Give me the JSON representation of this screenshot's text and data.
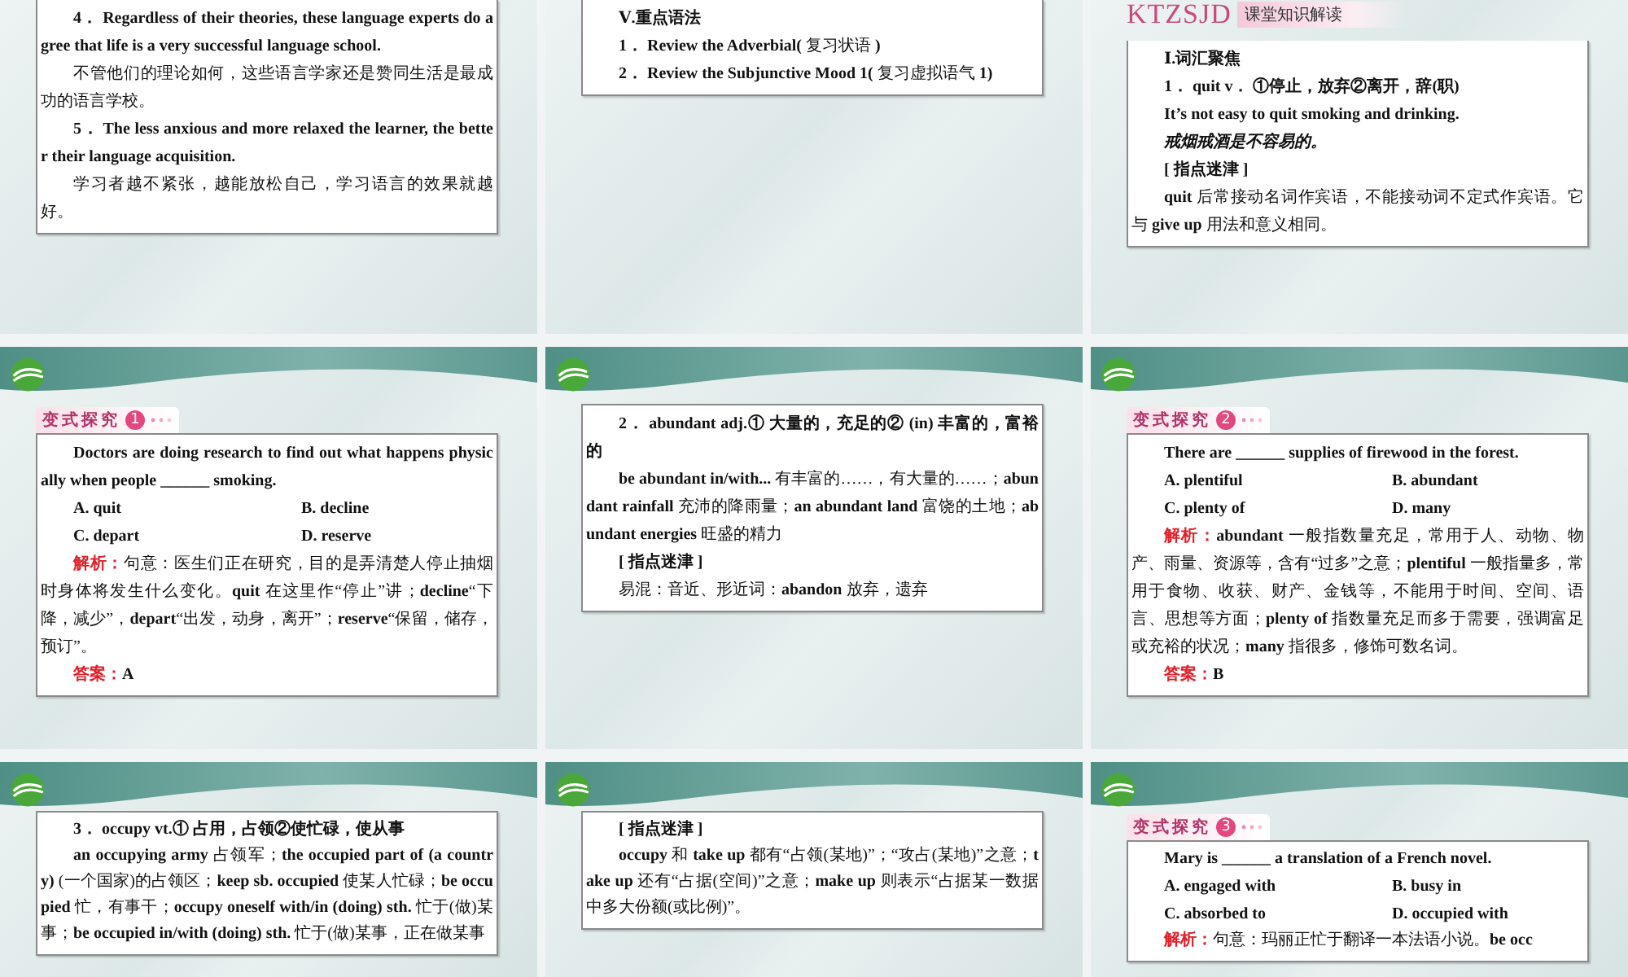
{
  "slides": [
    {
      "kind": "lower-part",
      "box": [
        {
          "kind": "strong",
          "text": "4． Regardless of their theories, these language experts do agree that life is a very successful language school."
        },
        {
          "kind": "body",
          "text": "不管他们的理论如何，这些语言学家还是赞同生活是最成功的语言学校。"
        },
        {
          "kind": "strong",
          "text": "5． The less anxious and more relaxed the learner, the better their language acquisition."
        },
        {
          "kind": "body",
          "text": "学习者越不紧张，越能放松自己，学习语言的效果就越好。"
        }
      ]
    },
    {
      "kind": "lower-part",
      "box": [
        {
          "kind": "strong",
          "text": "Ⅴ.重点语法"
        },
        {
          "kind": "body",
          "text": "**1． Review the Adverbial(** 复习状语 **)**"
        },
        {
          "kind": "body",
          "text": "**2． Review the Subjunctive Mood 1(** 复习虚拟语气 **1)**"
        }
      ]
    },
    {
      "kind": "lower-part",
      "section": {
        "code": "KTZSJD",
        "title": "课堂知识解读"
      },
      "box": [
        {
          "kind": "strong",
          "text": "Ⅰ.词汇聚焦"
        },
        {
          "kind": "strong",
          "text": "1． quit v． ①停止，放弃②离开，辞(职)"
        },
        {
          "kind": "strong",
          "text": "It’s not easy to quit smoking and drinking."
        },
        {
          "kind": "example",
          "text": "戒烟戒酒是不容易的。"
        },
        {
          "kind": "strong",
          "text": "[ 指点迷津 ]"
        },
        {
          "kind": "body",
          "text": "**quit** 后常接动名词作宾语，不能接动词不定式作宾语。它与 **give up** 用法和意义相同。"
        }
      ]
    },
    {
      "kind": "full",
      "tag": {
        "label": "变式探究",
        "number": "1"
      },
      "box": [
        {
          "kind": "strong",
          "text": "Doctors are doing research to find out what happens physically when people ______ smoking."
        },
        {
          "kind": "options",
          "options": [
            "A. quit",
            "B. decline"
          ]
        },
        {
          "kind": "options",
          "options": [
            "C. depart",
            "D. reserve"
          ]
        },
        {
          "kind": "note",
          "label": "解析：",
          "text": "句意：医生们正在研究，目的是弄清楚人停止抽烟时身体将发生什么变化。**quit** 在这里作“停止”讲；**decline**“下降，减少”，**depart**“出发，动身，离开”；**reserve**“保留，储存，预订”。"
        },
        {
          "kind": "note",
          "label": "答案：",
          "text": "**A**"
        }
      ]
    },
    {
      "kind": "full",
      "box": [
        {
          "kind": "strong",
          "text": "2． abundant adj.① 大量的，充足的② (in) 丰富的，富裕的"
        },
        {
          "kind": "body",
          "text": "**be abundant in/with...** 有丰富的……，有大量的……；**abundant rainfall** 充沛的降雨量；**an abundant land** 富饶的土地；**abundant energies** 旺盛的精力"
        },
        {
          "kind": "strong",
          "text": "[ 指点迷津 ]"
        },
        {
          "kind": "body",
          "text": "易混：音近、形近词：**abandon** 放弃，遗弃"
        }
      ]
    },
    {
      "kind": "full",
      "tag": {
        "label": "变式探究",
        "number": "2"
      },
      "box": [
        {
          "kind": "strong",
          "text": "There are ______ supplies of firewood in the forest."
        },
        {
          "kind": "options",
          "options": [
            "A. plentiful",
            "B. abundant"
          ]
        },
        {
          "kind": "options",
          "options": [
            "C. plenty of",
            "D. many"
          ]
        },
        {
          "kind": "note",
          "label": "解析：",
          "text": "**abundant** 一般指数量充足，常用于人、动物、物产、雨量、资源等，含有“过多”之意；**plentiful** 一般指量多，常用于食物、收获、财产、金钱等，不能用于时间、空间、语言、思想等方面；**plenty of** 指数量充足而多于需要，强调富足或充裕的状况；**many** 指很多，修饰可数名词。"
        },
        {
          "kind": "note",
          "label": "答案：",
          "text": "**B**"
        }
      ]
    },
    {
      "kind": "full",
      "box": [
        {
          "kind": "strong",
          "text": "3． occupy vt.① 占用，占领②使忙碌，使从事"
        },
        {
          "kind": "body",
          "text": "**an occupying army** 占领军；**the occupied part of (a country)** (一个国家)的占领区；**keep sb. occupied** 使某人忙碌；**be occupied** 忙，有事干；**occupy oneself with/in (doing) sth.** 忙于(做)某事；**be occupied in/with (doing) sth.** 忙于(做)某事，正在做某事"
        }
      ]
    },
    {
      "kind": "full",
      "box": [
        {
          "kind": "strong",
          "text": "[ 指点迷津 ]"
        },
        {
          "kind": "body",
          "text": "**occupy** 和 **take up** 都有“占领(某地)”；“攻占(某地)”之意；**take up** 还有“占据(空间)”之意；**make up** 则表示“占据某一数据中多大份额(或比例)”。"
        }
      ]
    },
    {
      "kind": "full",
      "tag": {
        "label": "变式探究",
        "number": "3"
      },
      "box": [
        {
          "kind": "strong",
          "text": "Mary is ______ a translation of a French novel."
        },
        {
          "kind": "options",
          "options": [
            "A. engaged with",
            "B. busy in"
          ]
        },
        {
          "kind": "options",
          "options": [
            "C. absorbed to",
            "D. occupied with"
          ]
        },
        {
          "kind": "note",
          "label": "解析：",
          "text": "句意：玛丽正忙于翻译一本法语小说。**be occ**"
        }
      ]
    }
  ]
}
